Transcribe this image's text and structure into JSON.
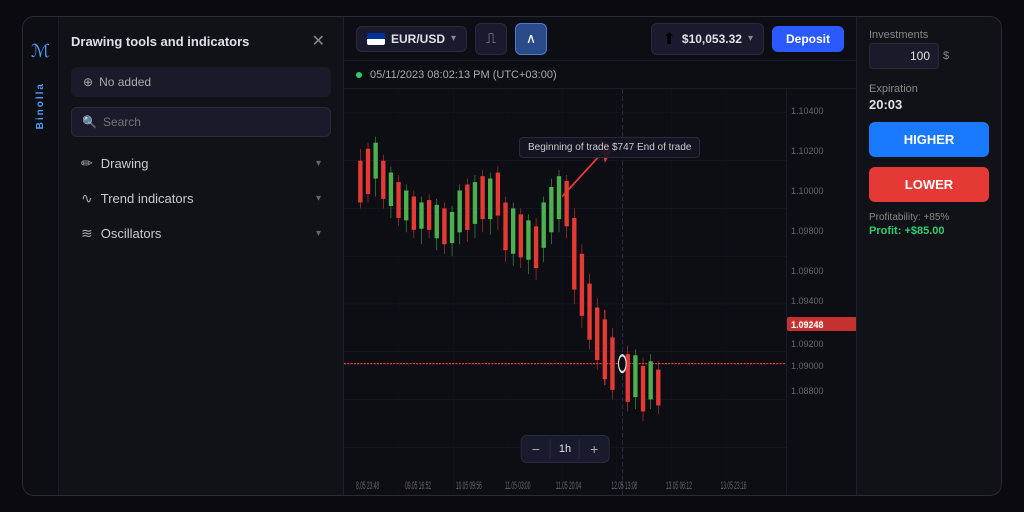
{
  "brand": {
    "name": "Binolla",
    "icon": "ℬ"
  },
  "panel": {
    "title": "Drawing tools and indicators",
    "no_added_label": "No added",
    "search_placeholder": "Search",
    "categories": [
      {
        "id": "drawing",
        "label": "Drawing",
        "icon": "✏️"
      },
      {
        "id": "trend",
        "label": "Trend indicators",
        "icon": "📈"
      },
      {
        "id": "oscillators",
        "label": "Oscillators",
        "icon": "📊"
      }
    ]
  },
  "toolbar": {
    "asset": "EUR/USD",
    "chart_icon": "📊",
    "indicator_icon": "🔔",
    "balance": "$10,053.32",
    "deposit_label": "Deposit"
  },
  "status": {
    "timestamp": "05/11/2023 08:02:13 PM (UTC+03:00)"
  },
  "chart": {
    "price_levels": [
      "1.10400",
      "1.10200",
      "1.10000",
      "1.09800",
      "1.09600",
      "1.09400",
      "1.09200",
      "1.09000",
      "1.08800"
    ],
    "current_price": "1.09248",
    "time_labels": [
      "8.05 23:48",
      "09.05 16:52",
      "10.05 09:56",
      "11.05 03:00",
      "11.05 20:04",
      "12.05 13:08",
      "13.05 06:12",
      "13.05 23:16"
    ],
    "annotation": {
      "text": "Beginning of trade $747 End of trade"
    },
    "zoom_level": "1h"
  },
  "trade": {
    "investments_label": "Investments",
    "investment_value": "100",
    "currency": "$",
    "expiration_label": "Expiration",
    "expiration_value": "20:03",
    "higher_label": "HIGHER",
    "lower_label": "LOWER",
    "profitability_label": "Profitability: +85%",
    "profit_label": "Profit: +$85.00"
  }
}
